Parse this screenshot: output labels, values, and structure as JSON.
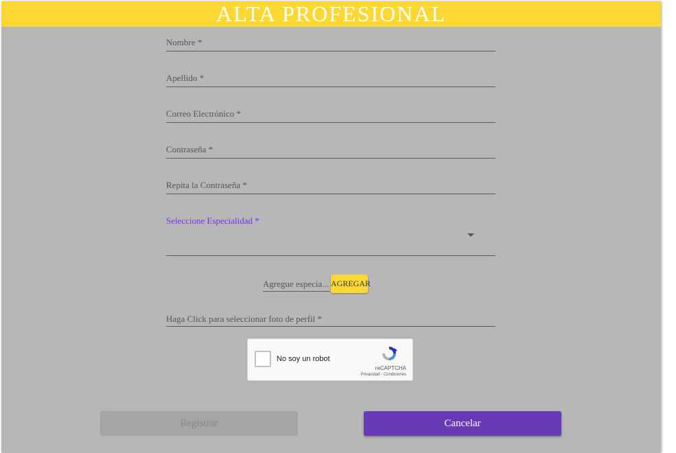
{
  "header": {
    "title": "ALTA PROFESIONAL"
  },
  "form": {
    "nombre_label": "Nombre *",
    "apellido_label": "Apellido *",
    "email_label": "Correo Electrónico *",
    "password_label": "Contraseña *",
    "repeat_password_label": "Repita la Contraseña *",
    "especialidad_label": "Seleccione Especialidad *",
    "agregue_placeholder": "Agregue especia...",
    "agregar_button": "AGREGAR",
    "foto_label": "Haga Click para seleccionar foto de perfil *"
  },
  "captcha": {
    "text": "No soy un robot",
    "brand": "reCAPTCHA",
    "terms": "Privacidad - Condiciones"
  },
  "actions": {
    "register": "Registrar",
    "cancel": "Cancelar"
  },
  "colors": {
    "header": "#fdd835",
    "card": "#b7b7b7",
    "accent": "#673ab7",
    "label_focus": "#7c2bf2"
  }
}
